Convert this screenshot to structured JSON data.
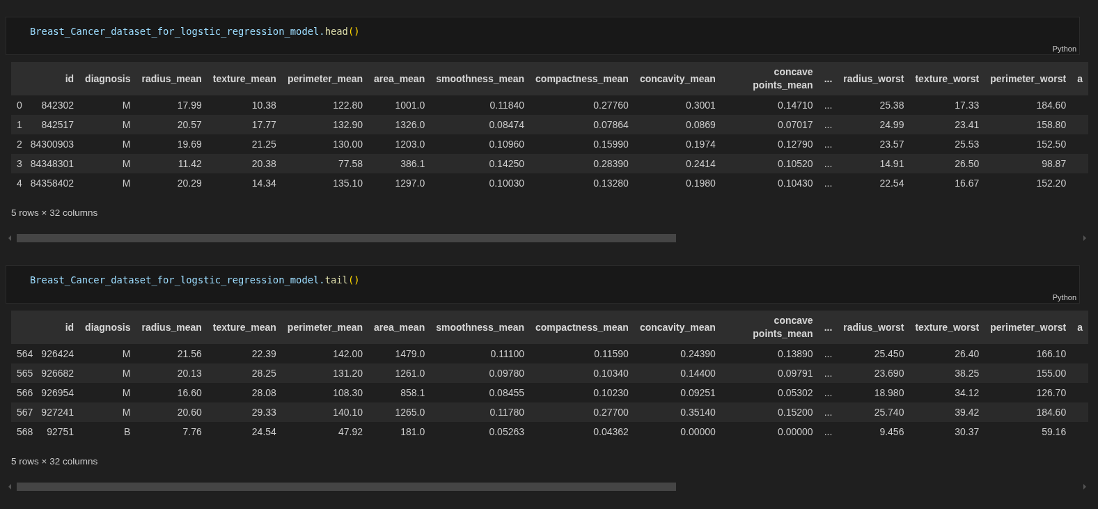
{
  "cells": [
    {
      "code": [
        {
          "text": "Breast_Cancer_dataset_for_logstic_regression_model.",
          "kind": "variable"
        },
        {
          "text": "head",
          "kind": "function"
        },
        {
          "text": "()",
          "kind": "bracket"
        }
      ],
      "language": "Python",
      "output": {
        "columns": [
          "",
          "id",
          "diagnosis",
          "radius_mean",
          "texture_mean",
          "perimeter_mean",
          "area_mean",
          "smoothness_mean",
          "compactness_mean",
          "concavity_mean",
          "concave points_mean",
          "...",
          "radius_worst",
          "texture_worst",
          "perimeter_worst",
          "a"
        ],
        "rows": [
          {
            "index": "0",
            "values": [
              "842302",
              "M",
              "17.99",
              "10.38",
              "122.80",
              "1001.0",
              "0.11840",
              "0.27760",
              "0.3001",
              "0.14710",
              "...",
              "25.38",
              "17.33",
              "184.60"
            ]
          },
          {
            "index": "1",
            "values": [
              "842517",
              "M",
              "20.57",
              "17.77",
              "132.90",
              "1326.0",
              "0.08474",
              "0.07864",
              "0.0869",
              "0.07017",
              "...",
              "24.99",
              "23.41",
              "158.80"
            ]
          },
          {
            "index": "2",
            "values": [
              "84300903",
              "M",
              "19.69",
              "21.25",
              "130.00",
              "1203.0",
              "0.10960",
              "0.15990",
              "0.1974",
              "0.12790",
              "...",
              "23.57",
              "25.53",
              "152.50"
            ]
          },
          {
            "index": "3",
            "values": [
              "84348301",
              "M",
              "11.42",
              "20.38",
              "77.58",
              "386.1",
              "0.14250",
              "0.28390",
              "0.2414",
              "0.10520",
              "...",
              "14.91",
              "26.50",
              "98.87"
            ]
          },
          {
            "index": "4",
            "values": [
              "84358402",
              "M",
              "20.29",
              "14.34",
              "135.10",
              "1297.0",
              "0.10030",
              "0.13280",
              "0.1980",
              "0.10430",
              "...",
              "22.54",
              "16.67",
              "152.20"
            ]
          }
        ],
        "summary": "5 rows × 32 columns"
      }
    },
    {
      "code": [
        {
          "text": "Breast_Cancer_dataset_for_logstic_regression_model.",
          "kind": "variable"
        },
        {
          "text": "tail",
          "kind": "function"
        },
        {
          "text": "()",
          "kind": "bracket"
        }
      ],
      "language": "Python",
      "output": {
        "columns": [
          "",
          "id",
          "diagnosis",
          "radius_mean",
          "texture_mean",
          "perimeter_mean",
          "area_mean",
          "smoothness_mean",
          "compactness_mean",
          "concavity_mean",
          "concave points_mean",
          "...",
          "radius_worst",
          "texture_worst",
          "perimeter_worst",
          "a"
        ],
        "rows": [
          {
            "index": "564",
            "values": [
              "926424",
              "M",
              "21.56",
              "22.39",
              "142.00",
              "1479.0",
              "0.11100",
              "0.11590",
              "0.24390",
              "0.13890",
              "...",
              "25.450",
              "26.40",
              "166.10"
            ]
          },
          {
            "index": "565",
            "values": [
              "926682",
              "M",
              "20.13",
              "28.25",
              "131.20",
              "1261.0",
              "0.09780",
              "0.10340",
              "0.14400",
              "0.09791",
              "...",
              "23.690",
              "38.25",
              "155.00"
            ]
          },
          {
            "index": "566",
            "values": [
              "926954",
              "M",
              "16.60",
              "28.08",
              "108.30",
              "858.1",
              "0.08455",
              "0.10230",
              "0.09251",
              "0.05302",
              "...",
              "18.980",
              "34.12",
              "126.70"
            ]
          },
          {
            "index": "567",
            "values": [
              "927241",
              "M",
              "20.60",
              "29.33",
              "140.10",
              "1265.0",
              "0.11780",
              "0.27700",
              "0.35140",
              "0.15200",
              "...",
              "25.740",
              "39.42",
              "184.60"
            ]
          },
          {
            "index": "568",
            "values": [
              "92751",
              "B",
              "7.76",
              "24.54",
              "47.92",
              "181.0",
              "0.05263",
              "0.04362",
              "0.00000",
              "0.00000",
              "...",
              "9.456",
              "30.37",
              "59.16"
            ]
          }
        ],
        "summary": "5 rows × 32 columns"
      }
    }
  ]
}
